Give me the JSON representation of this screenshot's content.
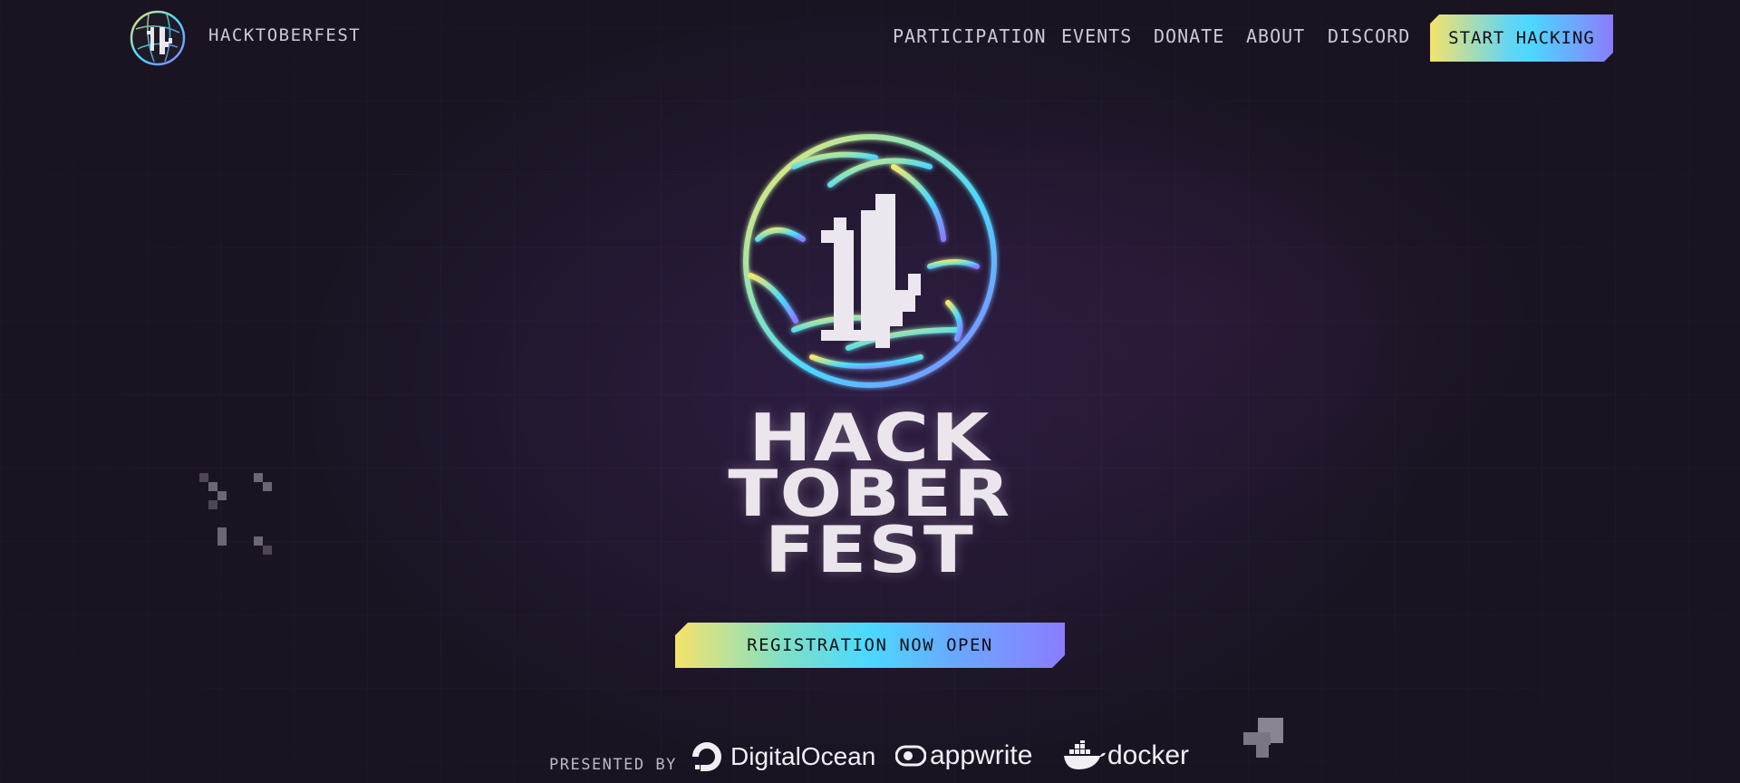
{
  "header": {
    "brand": "HACKTOBERFEST",
    "logo_icon": "hacktoberfest-11-logo-icon",
    "nav": [
      {
        "label": "PARTICIPATION"
      },
      {
        "label": "EVENTS"
      },
      {
        "label": "DONATE"
      },
      {
        "label": "ABOUT"
      },
      {
        "label": "DISCORD"
      }
    ],
    "cta": "START HACKING"
  },
  "hero": {
    "logo_number": "11",
    "wordmark": [
      "HACK",
      "TOBER",
      "FEST"
    ],
    "cta": "REGISTRATION NOW OPEN"
  },
  "sponsors": {
    "label": "PRESENTED BY",
    "items": [
      {
        "name": "DigitalOcean",
        "icon": "digitalocean-icon"
      },
      {
        "name": "appwrite",
        "icon": "appwrite-icon"
      },
      {
        "name": "docker",
        "icon": "docker-icon"
      }
    ]
  },
  "colors": {
    "background": "#1a1422",
    "gradient": [
      "#f5e36a",
      "#4bd8ff",
      "#8b7cff"
    ],
    "text": "#cfc8d6"
  }
}
